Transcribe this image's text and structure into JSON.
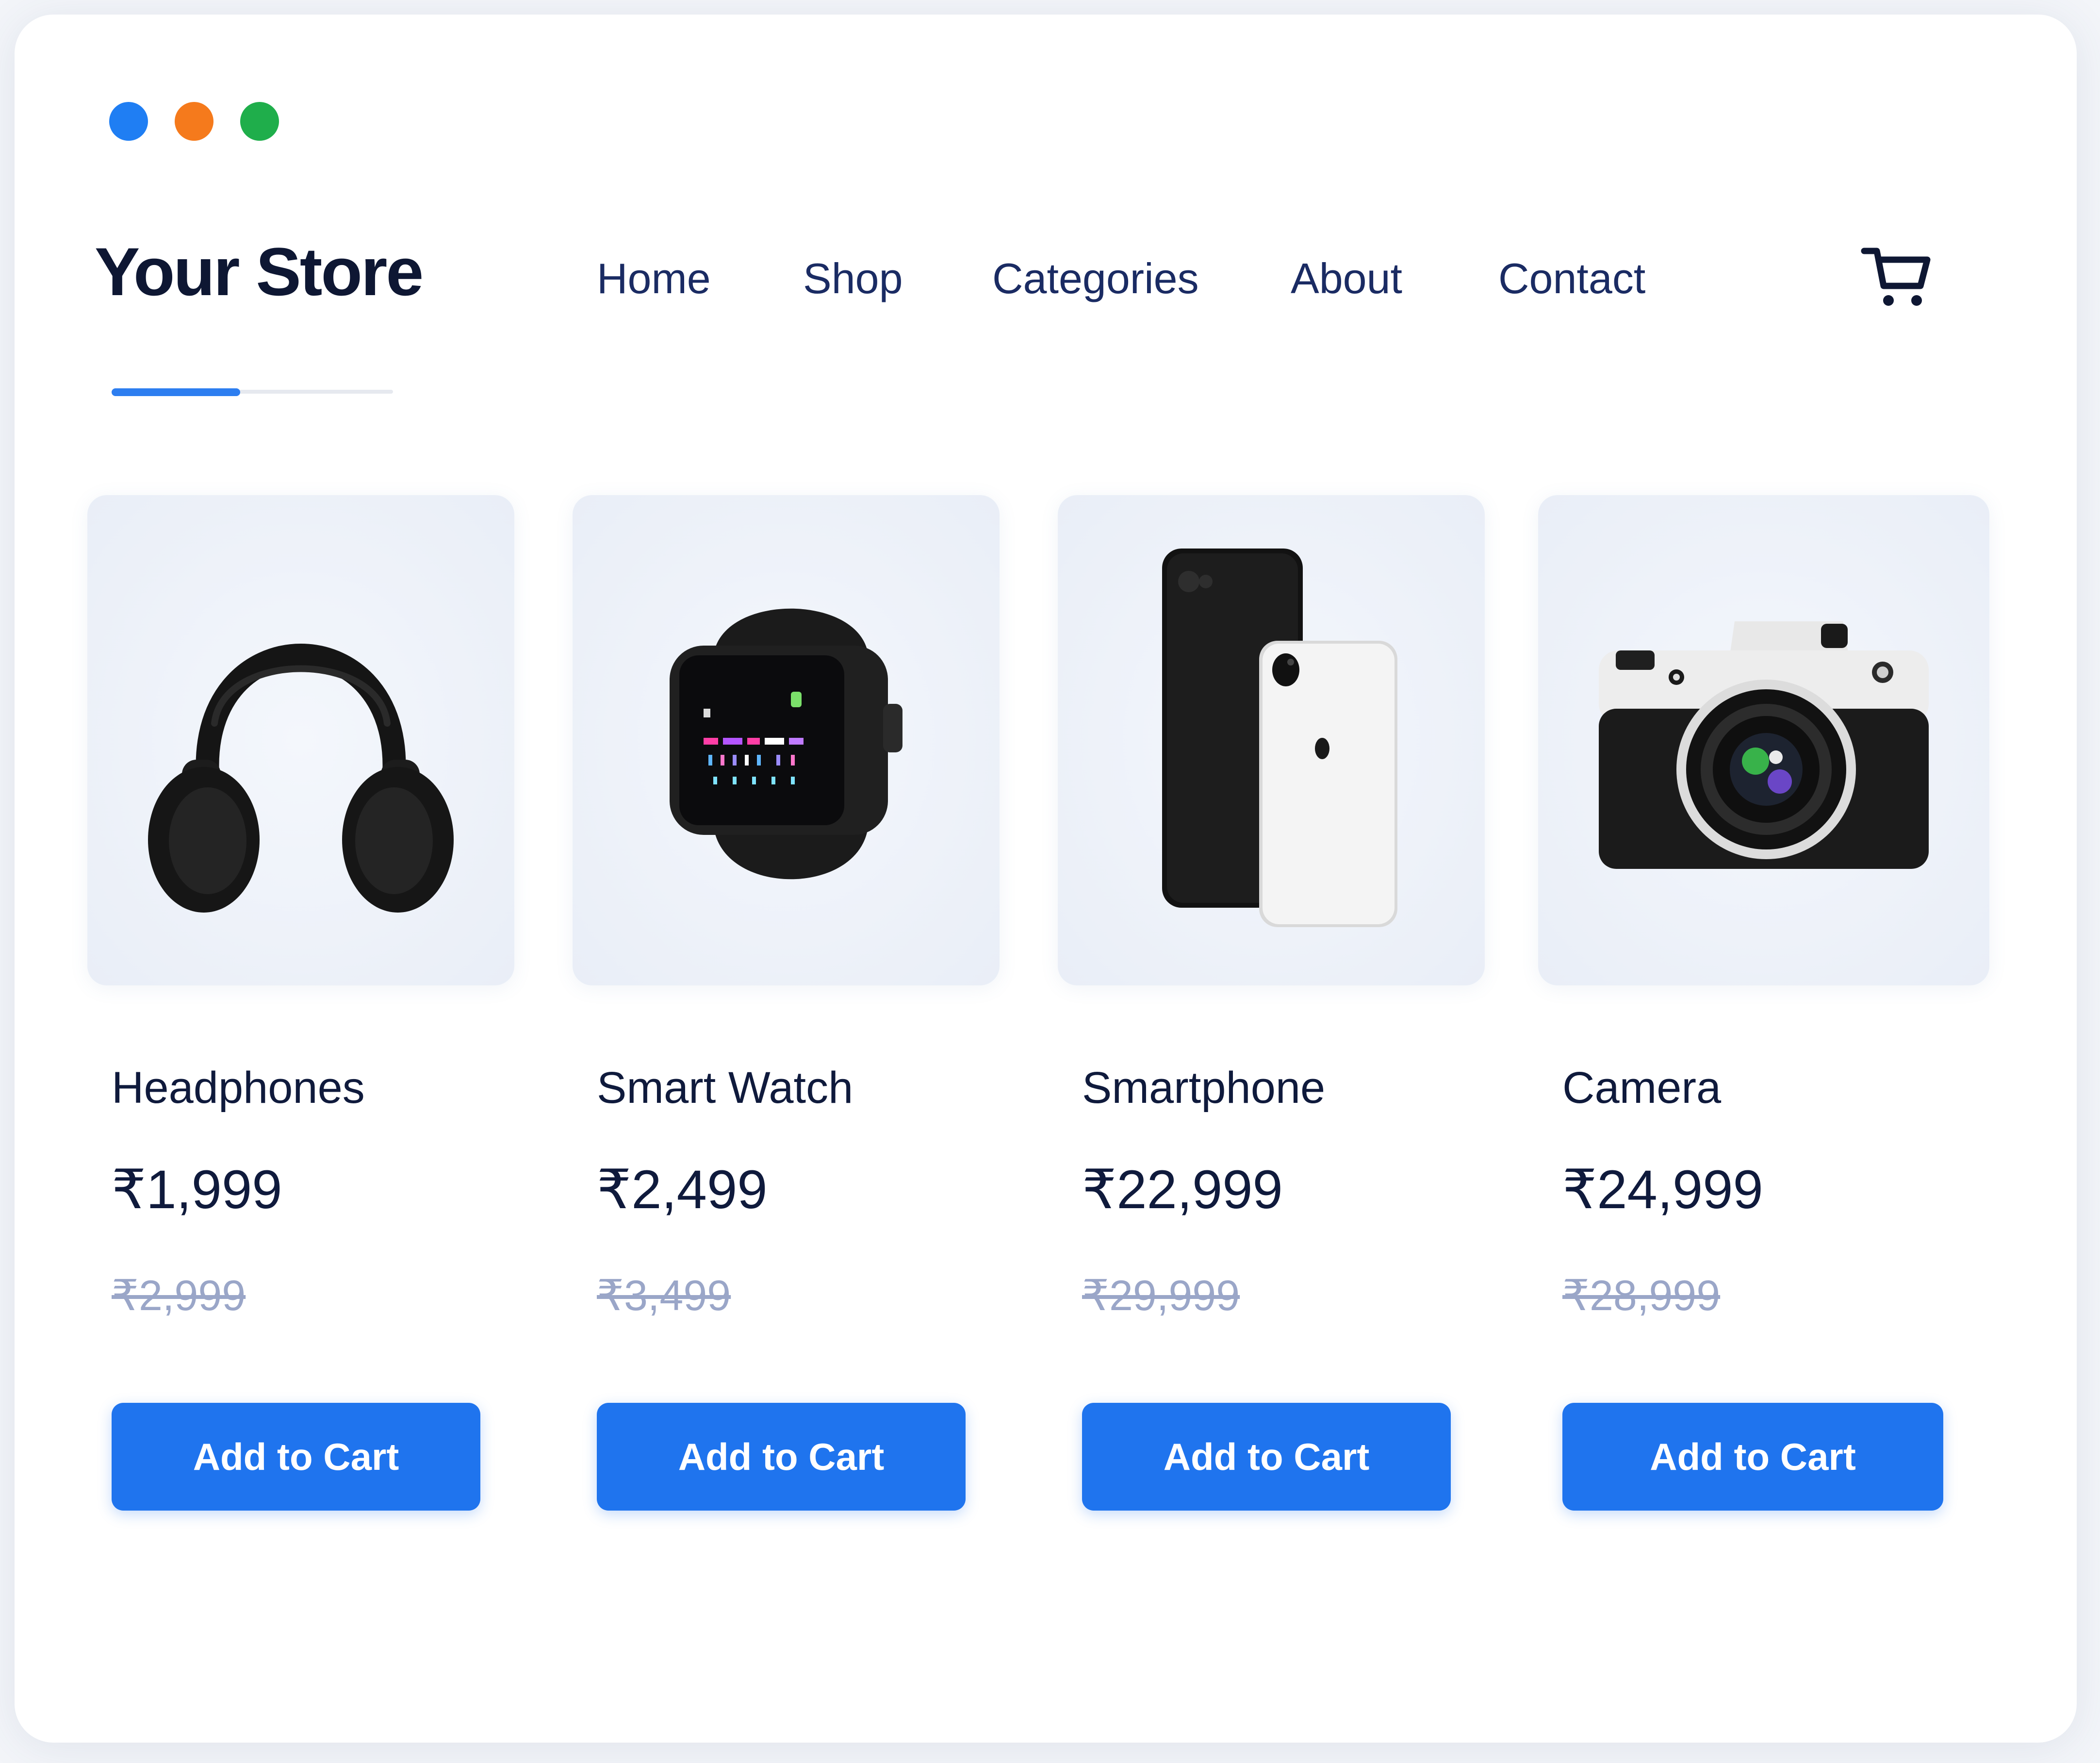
{
  "window": {
    "controls": [
      "blue-dot",
      "orange-dot",
      "green-dot"
    ],
    "colors": {
      "blue": "#1f7ef3",
      "orange": "#f57a1c",
      "green": "#1fae4b"
    }
  },
  "header": {
    "brand": "Your Store",
    "nav": [
      "Home",
      "Shop",
      "Categories",
      "About",
      "Contact"
    ],
    "cart_icon": "cart-icon"
  },
  "theme": {
    "accent": "#1f74ee",
    "text": "#0f1a3c",
    "muted": "#9aa6c8"
  },
  "products": [
    {
      "name": "Headphones",
      "price": "₹1,999",
      "old_price": "₹2,999",
      "button": "Add to Cart",
      "icon": "headphones-icon"
    },
    {
      "name": "Smart Watch",
      "price": "₹2,499",
      "old_price": "₹3,499",
      "button": "Add to Cart",
      "icon": "smartwatch-icon"
    },
    {
      "name": "Smartphone",
      "price": "₹22,999",
      "old_price": "₹29,999",
      "button": "Add to Cart",
      "icon": "smartphone-icon"
    },
    {
      "name": "Camera",
      "price": "₹24,999",
      "old_price": "₹28,999",
      "button": "Add to Cart",
      "icon": "camera-icon"
    }
  ]
}
